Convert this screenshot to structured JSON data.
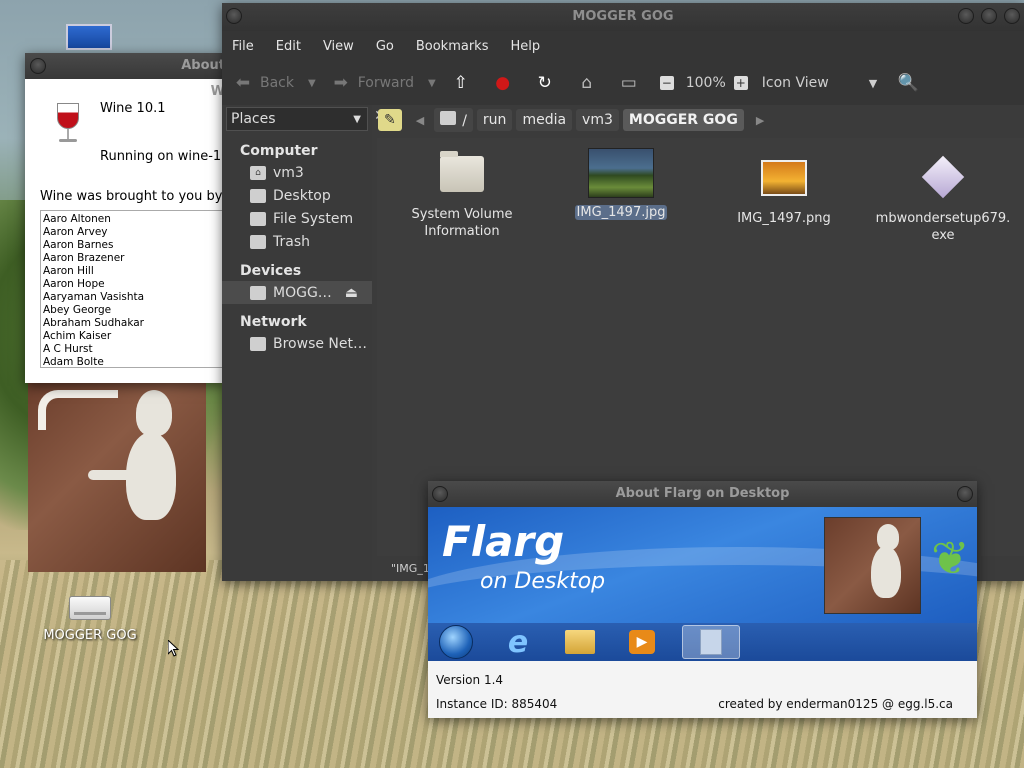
{
  "desktop": {
    "drive_label": "MOGGER GOG"
  },
  "wine_about": {
    "title": "About W",
    "product": "Wine 10.1",
    "running": "Running on wine-10.1",
    "brought_by": "Wine was brought to you by:",
    "credits": [
      "Aaro Altonen",
      "Aaron Arvey",
      "Aaron Barnes",
      "Aaron Brazener",
      "Aaron Hill",
      "Aaron Hope",
      "Aaryaman Vasishta",
      "Abey George",
      "Abraham Sudhakar",
      "Achim Kaiser",
      "A C Hurst",
      "Adam Bolte"
    ]
  },
  "file_manager": {
    "title": "MOGGER GOG",
    "menu": [
      "File",
      "Edit",
      "View",
      "Go",
      "Bookmarks",
      "Help"
    ],
    "toolbar": {
      "back": "Back",
      "forward": "Forward",
      "zoom": "100%",
      "view_mode": "Icon View"
    },
    "sidebar": {
      "selector": "Places",
      "sections": [
        {
          "heading": "Computer",
          "items": [
            "vm3",
            "Desktop",
            "File System",
            "Trash"
          ]
        },
        {
          "heading": "Devices",
          "items": [
            "MOGG…"
          ]
        },
        {
          "heading": "Network",
          "items": [
            "Browse Net…"
          ]
        }
      ]
    },
    "path": [
      "/",
      "run",
      "media",
      "vm3",
      "MOGGER GOG"
    ],
    "files": [
      {
        "name": "System Volume Information",
        "line1": "System Volume",
        "line2": "Information"
      },
      {
        "name": "IMG_1497.jpg",
        "line1": "IMG_1497.jpg",
        "line2": ""
      },
      {
        "name": "IMG_1497.png",
        "line1": "IMG_1497.png",
        "line2": ""
      },
      {
        "name": "mbwondersetup679.exe",
        "line1": "mbwondersetup679.",
        "line2": "exe"
      }
    ],
    "status": "\"IMG_1"
  },
  "flarg_about": {
    "title": "About Flarg on Desktop",
    "banner_title": "Flarg",
    "banner_subtitle": "on Desktop",
    "version": "Version 1.4",
    "instance": "Instance ID:  885404",
    "created": "created by enderman0125 @ egg.l5.ca"
  }
}
